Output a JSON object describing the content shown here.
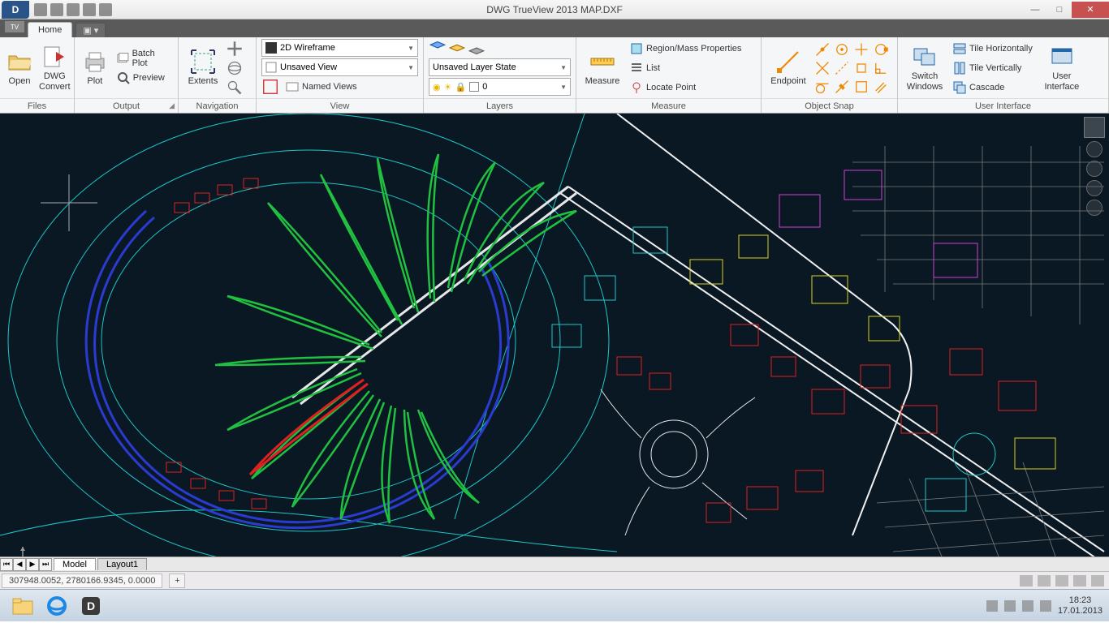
{
  "app": {
    "title": "DWG TrueView 2013    MAP.DXF",
    "logo": "D"
  },
  "tabs": {
    "home": "Home",
    "secondary": "▣ ▾",
    "tv": "TV"
  },
  "ribbon": {
    "files": {
      "title": "Files",
      "open": "Open",
      "dwg_convert": "DWG Convert"
    },
    "output": {
      "title": "Output",
      "plot": "Plot",
      "batch_plot": "Batch Plot",
      "preview": "Preview"
    },
    "navigation": {
      "title": "Navigation",
      "extents": "Extents"
    },
    "view": {
      "title": "View",
      "visual_style": "2D Wireframe",
      "named_view": "Unsaved View",
      "named_views": "Named Views"
    },
    "layers": {
      "title": "Layers",
      "layer_state": "Unsaved Layer State",
      "current_layer": "0"
    },
    "measure": {
      "title": "Measure",
      "measure": "Measure",
      "region": "Region/Mass Properties",
      "list": "List",
      "locate": "Locate Point"
    },
    "osnap": {
      "title": "Object Snap",
      "endpoint": "Endpoint"
    },
    "ui": {
      "title": "User Interface",
      "switch_windows": "Switch Windows",
      "tile_h": "Tile Horizontally",
      "tile_v": "Tile Vertically",
      "cascade": "Cascade",
      "user_interface": "User Interface"
    }
  },
  "model_tabs": {
    "model": "Model",
    "layout1": "Layout1"
  },
  "status": {
    "coords": "307948.0052, 2780166.9345, 0.0000"
  },
  "taskbar": {
    "time": "18:23",
    "date": "17.01.2013"
  }
}
